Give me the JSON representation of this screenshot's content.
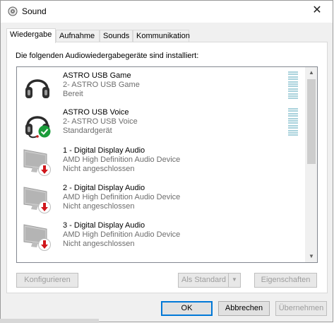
{
  "window": {
    "title": "Sound"
  },
  "tabs": [
    {
      "label": "Wiedergabe",
      "active": true
    },
    {
      "label": "Aufnahme"
    },
    {
      "label": "Sounds"
    },
    {
      "label": "Kommunikation"
    }
  ],
  "heading": "Die folgenden Audiowiedergabegeräte sind installiert:",
  "devices": [
    {
      "name": "ASTRO USB Game",
      "sub": "2- ASTRO USB Game",
      "status": "Bereit",
      "icon": "headphones-icon",
      "badge": "none",
      "meter": true
    },
    {
      "name": "ASTRO USB Voice",
      "sub": "2- ASTRO USB Voice",
      "status": "Standardgerät",
      "icon": "headset-icon",
      "badge": "default-check",
      "meter": true
    },
    {
      "name": "1 - Digital Display Audio",
      "sub": "AMD High Definition Audio Device",
      "status": "Nicht angeschlossen",
      "icon": "monitor-icon",
      "badge": "unplugged"
    },
    {
      "name": "2 - Digital Display Audio",
      "sub": "AMD High Definition Audio Device",
      "status": "Nicht angeschlossen",
      "icon": "monitor-icon",
      "badge": "unplugged"
    },
    {
      "name": "3 - Digital Display Audio",
      "sub": "AMD High Definition Audio Device",
      "status": "Nicht angeschlossen",
      "icon": "monitor-icon",
      "badge": "unplugged"
    }
  ],
  "buttons": {
    "configure": "Konfigurieren",
    "set_default": "Als Standard",
    "properties": "Eigenschaften",
    "ok": "OK",
    "cancel": "Abbrechen",
    "apply": "Übernehmen"
  },
  "colors": {
    "accent": "#0078d7",
    "check_green": "#1a9c3a",
    "unplugged_red": "#d0161b"
  }
}
